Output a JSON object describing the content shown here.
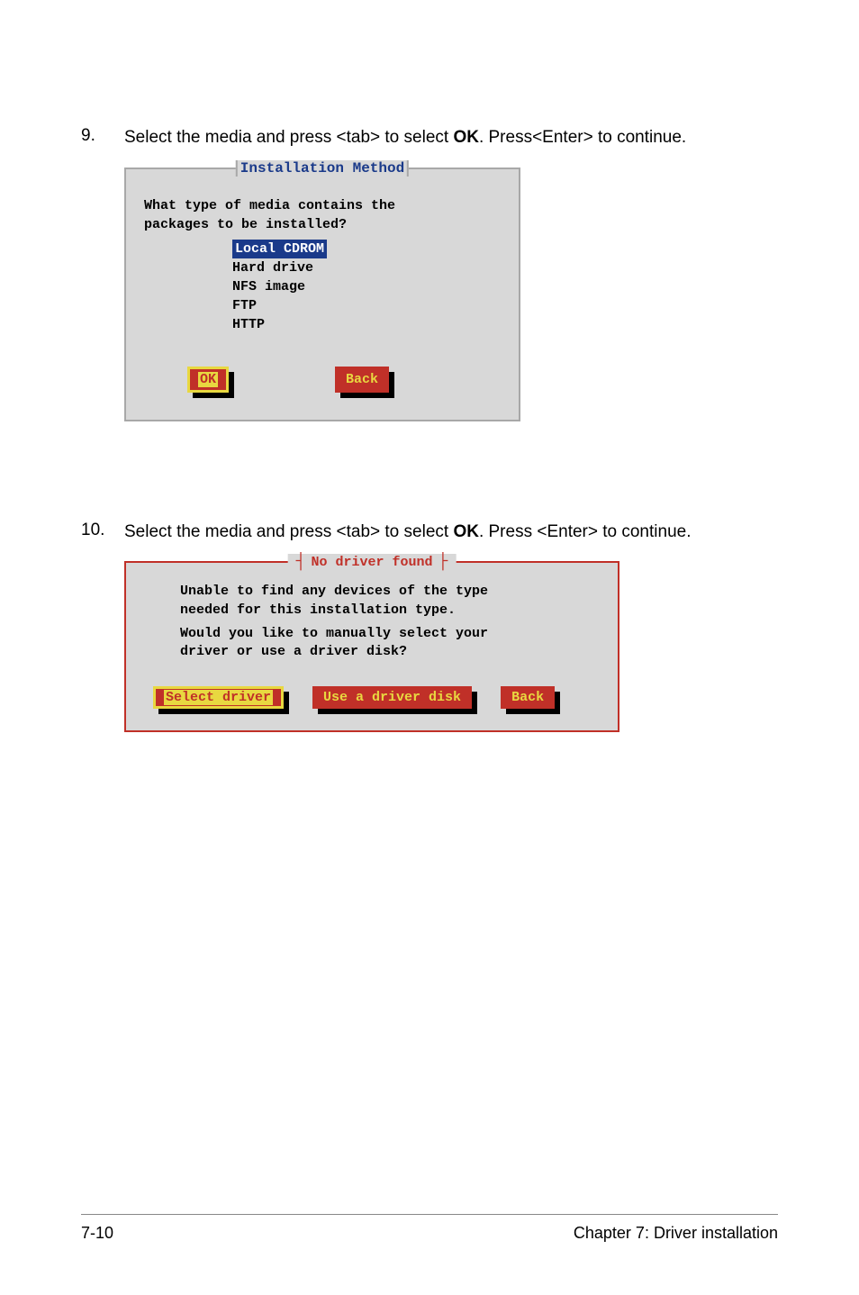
{
  "step1": {
    "num": "9.",
    "text_before": "Select the media and press <tab> to select ",
    "bold": "OK",
    "text_after": ". Press<Enter> to continue."
  },
  "dialog1": {
    "title": "Installation Method",
    "prompt_line1": "What type of media contains the",
    "prompt_line2": "packages to be installed?",
    "items": {
      "0": "Local CDROM",
      "1": "Hard drive",
      "2": "NFS image",
      "3": "FTP",
      "4": "HTTP"
    },
    "ok_label": "OK",
    "back_label": "Back"
  },
  "step2": {
    "num": "10.",
    "text_before": "Select the media and press <tab> to select ",
    "bold": "OK",
    "text_after": ". Press <Enter> to continue."
  },
  "dialog2": {
    "title": "No driver found",
    "line1": "Unable to find any devices of the type",
    "line2": "needed for this installation type.",
    "line3": "Would you like to manually select your",
    "line4": "driver or use a driver disk?",
    "select_driver_label": "Select driver",
    "use_disk_label": "Use a driver disk",
    "back_label": "Back"
  },
  "footer": {
    "page": "7-10",
    "chapter": "Chapter 7: Driver installation"
  }
}
